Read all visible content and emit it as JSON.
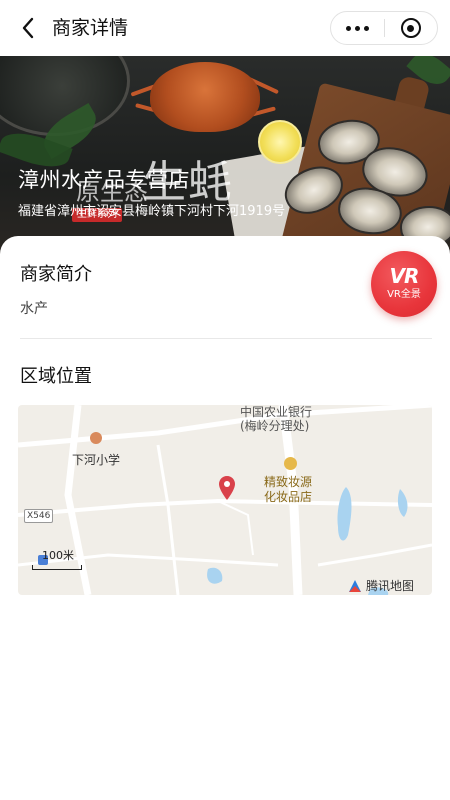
{
  "nav": {
    "title": "商家详情"
  },
  "banner": {
    "title": "漳州水产品专营店",
    "address": "福建省漳州市诏安县梅岭镇下河村下河1919号",
    "overlay_big": "生蚝",
    "overlay_mid": "原生态",
    "overlay_tag": "生鲜系列"
  },
  "intro": {
    "title": "商家简介",
    "text": "水产"
  },
  "vr": {
    "logo": "VR",
    "label": "VR全景"
  },
  "location": {
    "title": "区域位置"
  },
  "map": {
    "bank_line1": "中国农业银行",
    "bank_line2": "(梅岭分理处)",
    "school": "下河小学",
    "shop_line1": "精致妆源",
    "shop_line2": "化妆品店",
    "road": "X546",
    "scale": "100米",
    "provider": "腾讯地图"
  },
  "colors": {
    "accent": "#e8353b",
    "marker": "#d9414a",
    "water": "#a9d3f0"
  },
  "icons": {
    "back": "back-arrow-icon",
    "more": "more-dots-icon",
    "close": "mini-program-close-icon",
    "marker": "location-pin-icon"
  }
}
